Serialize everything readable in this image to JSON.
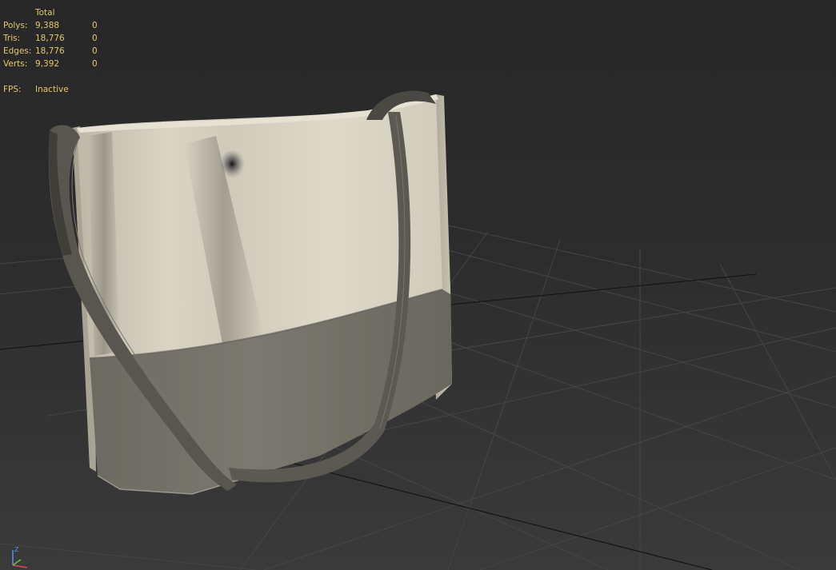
{
  "stats": {
    "header": "Total",
    "rows": [
      {
        "label": "Polys:",
        "total": "9,388",
        "selected": "0"
      },
      {
        "label": "Tris:",
        "total": "18,776",
        "selected": "0"
      },
      {
        "label": "Edges:",
        "total": "18,776",
        "selected": "0"
      },
      {
        "label": "Verts:",
        "total": "9,392",
        "selected": "0"
      }
    ],
    "fps_label": "FPS:",
    "fps_value": "Inactive"
  },
  "axis": {
    "z_label": "Z",
    "x_color": "#d94a4a",
    "y_color": "#4ad04a",
    "z_color": "#5a8ee8"
  },
  "colors": {
    "stats_text": "#e3c86a",
    "bag_canvas": "#d8d3c2",
    "bag_bottom": "#74716a",
    "strap": "#55534b"
  }
}
